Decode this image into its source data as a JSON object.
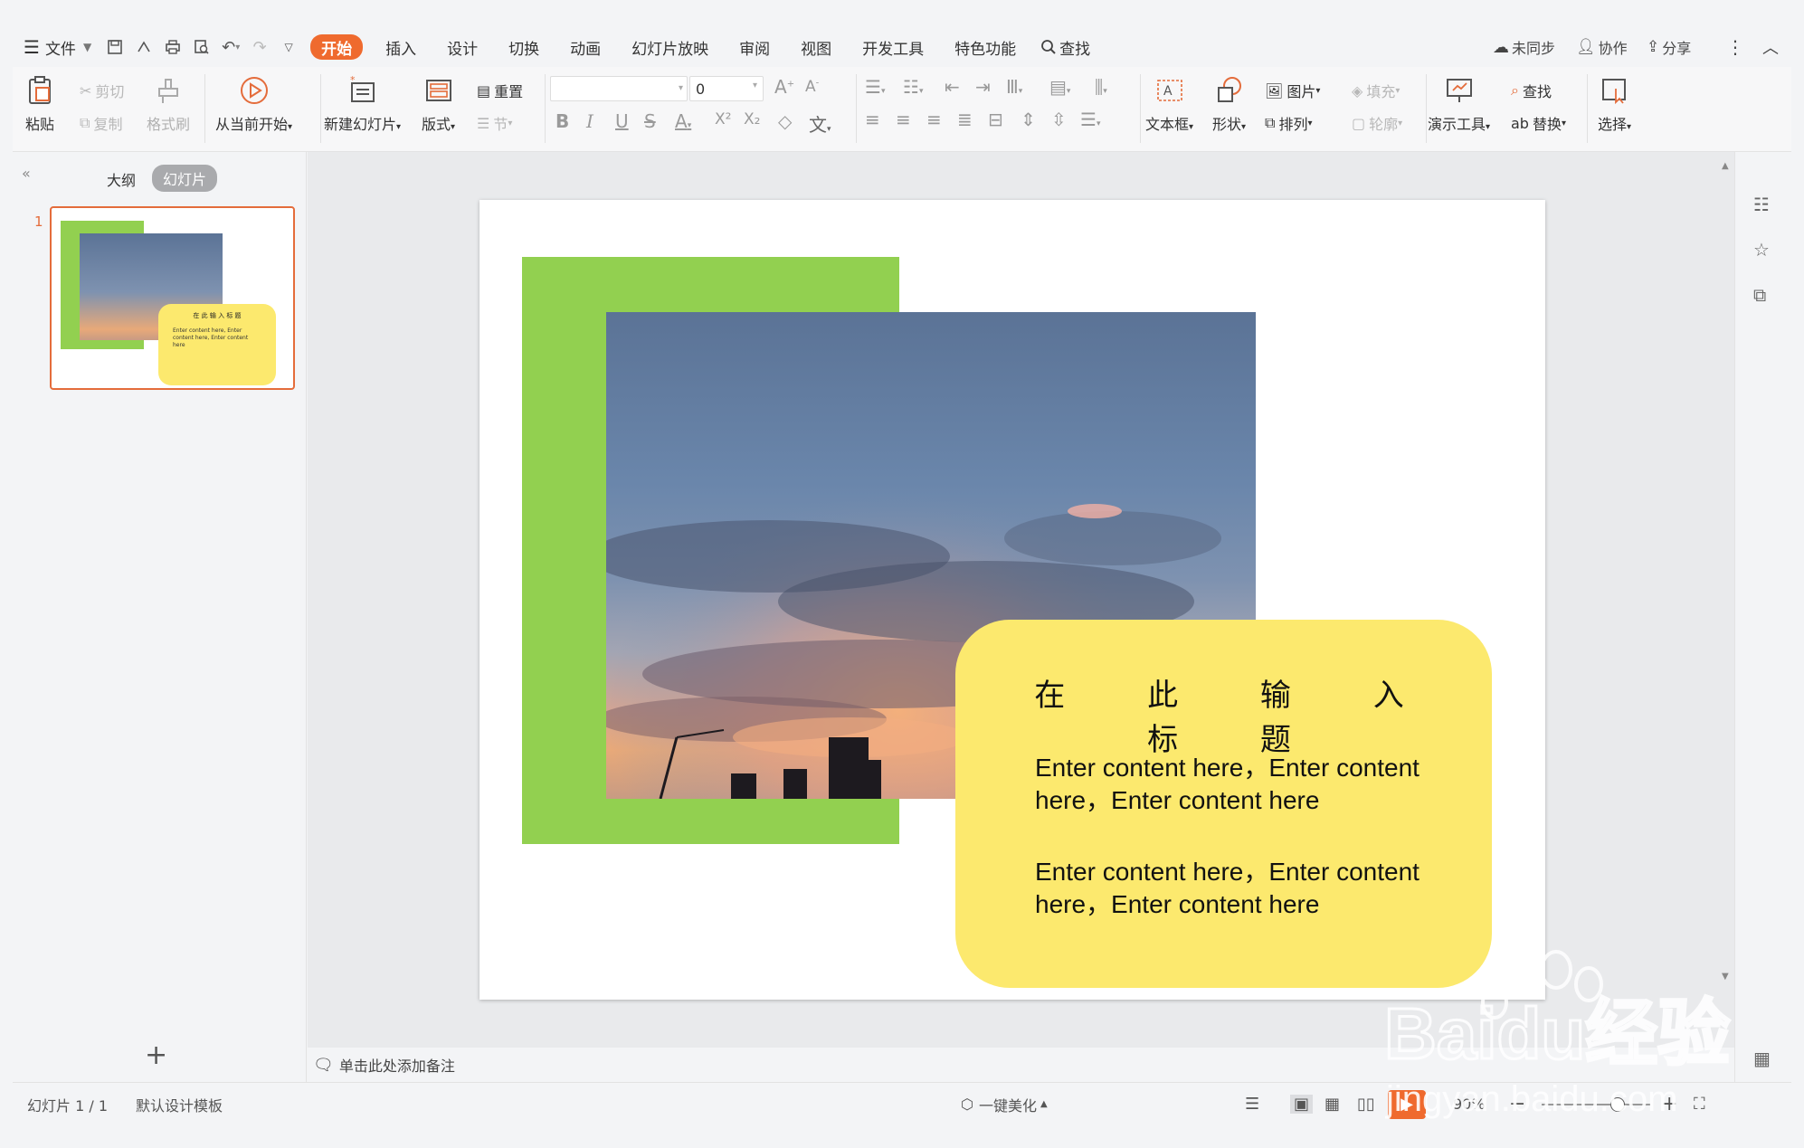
{
  "menubar": {
    "file_label": "文件",
    "tabs": [
      "开始",
      "插入",
      "设计",
      "切换",
      "动画",
      "幻灯片放映",
      "审阅",
      "视图",
      "开发工具",
      "特色功能"
    ],
    "search_label": "查找",
    "sync_label": "未同步",
    "collab_label": "协作",
    "share_label": "分享"
  },
  "ribbon": {
    "paste": "粘贴",
    "cut": "剪切",
    "copy": "复制",
    "format_painter": "格式刷",
    "play_from_current": "从当前开始",
    "new_slide": "新建幻灯片",
    "layout": "版式",
    "reset": "重置",
    "section": "节",
    "font_size_value": "0",
    "textbox": "文本框",
    "shape": "形状",
    "picture": "图片",
    "fill": "填充",
    "arrange": "排列",
    "outline": "轮廓",
    "presenter_tools": "演示工具",
    "find": "查找",
    "replace": "替换",
    "select": "选择"
  },
  "leftpanel": {
    "outline_tab": "大纲",
    "slides_tab": "幻灯片",
    "slide_number": "1",
    "thumb_title": "在 此 输 入 标 题",
    "thumb_text": "Enter content here, Enter content here, Enter content here"
  },
  "slide": {
    "title": "在 此 输 入 标 题",
    "paragraph1": "Enter content here，Enter content here，Enter content here",
    "paragraph2": "Enter content here，Enter content here，Enter content here"
  },
  "notes": {
    "placeholder": "单击此处添加备注"
  },
  "status": {
    "slide_count": "幻灯片 1 / 1",
    "template": "默认设计模板",
    "beautify": "一键美化",
    "zoom": "90%"
  },
  "watermark": {
    "brand": "Baidu经验",
    "url": "jingyan.baidu.com"
  },
  "colors": {
    "accent": "#ef6a2e",
    "green_block": "#92d050",
    "yellow_box": "#fce96e"
  }
}
